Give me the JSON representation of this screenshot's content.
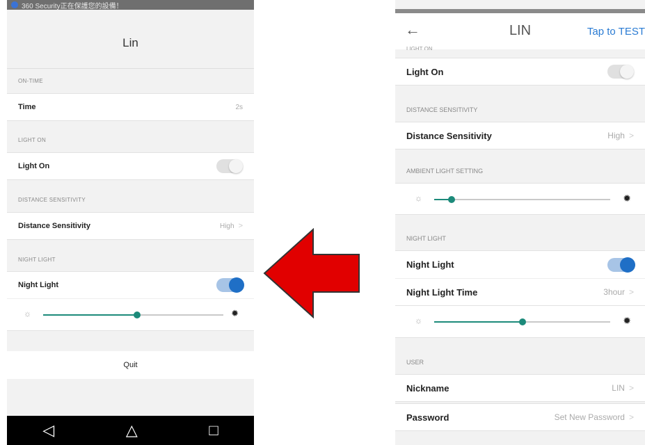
{
  "left": {
    "status_text": "360 Security正在保護您的設備！",
    "title": "Lin",
    "on_time": {
      "section": "ON-TIME",
      "label": "Time",
      "value": "2s"
    },
    "light_on": {
      "section": "LIGHT ON",
      "label": "Light On",
      "toggle": "off"
    },
    "distance": {
      "section": "DISTANCE SENSITIVITY",
      "label": "Distance Sensitivity",
      "value": "High"
    },
    "night_light": {
      "section": "NIGHT LIGHT",
      "label": "Night Light",
      "toggle": "on",
      "brightness_percent": 52
    },
    "quit_label": "Quit",
    "nav": {
      "back": "◁",
      "home": "△",
      "recent": "□"
    }
  },
  "right": {
    "back": "←",
    "title": "LIN",
    "test_label": "Tap to TEST",
    "cut_section": "LIGHT ON",
    "light_on": {
      "label": "Light On",
      "toggle": "off"
    },
    "distance": {
      "section": "DISTANCE SENSITIVITY",
      "label": "Distance Sensitivity",
      "value": "High"
    },
    "ambient": {
      "section": "AMBIENT LIGHT SETTING",
      "level_percent": 10
    },
    "night_light": {
      "section": "NIGHT LIGHT",
      "label": "Night Light",
      "toggle": "on"
    },
    "night_time": {
      "label": "Night Light Time",
      "value": "3hour",
      "brightness_percent": 50
    },
    "user": {
      "section": "USER",
      "nickname_label": "Nickname",
      "nickname_value": "LIN",
      "password_label": "Password",
      "password_value": "Set New Password"
    }
  },
  "colors": {
    "accent": "#1f6fc6",
    "slider": "#1c8a7a",
    "arrow": "#e10000",
    "link": "#2a7bd3"
  }
}
